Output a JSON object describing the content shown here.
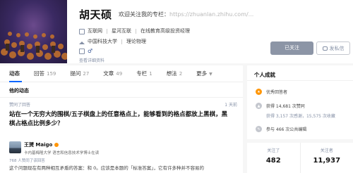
{
  "profile": {
    "name": "胡天硕",
    "headline_prefix": "欢迎关注我的专栏：",
    "headline_blurred": "https://zhuanlan.zhihu.com/...",
    "industry": "互联网",
    "company": "星河互联",
    "position": "在线教育高级投资经理",
    "school": "中国科技大学",
    "major": "理论物理",
    "gender_symbol": "♂",
    "edit_link": "查看详细资料"
  },
  "actions": {
    "follow_label": "已关注",
    "message_label": "发私信"
  },
  "tabs": [
    {
      "label": "动态",
      "count": ""
    },
    {
      "label": "回答",
      "count": "159"
    },
    {
      "label": "提问",
      "count": "27"
    },
    {
      "label": "文章",
      "count": "49"
    },
    {
      "label": "专栏",
      "count": "1"
    },
    {
      "label": "想法",
      "count": "2"
    },
    {
      "label": "更多",
      "count": ""
    }
  ],
  "feed": {
    "section_title": "他的动态",
    "item": {
      "action_label": "赞同了回答",
      "time": "1 天前",
      "question_title": "站在一个无穷大的围棋/五子棋盘上的任意格点上，能够看到的格点都放上黑棋，黑棋占格点比例多少？",
      "author_name": "王赟 Maigo",
      "author_bio": "卡内基梅隆大学 语言和信息技术学博士在读",
      "agree_count": "768 人赞同了该回答",
      "excerpt": "这个问题现在有两种相互矛盾的答案：和 0。应该是本题的「标准答案」，它有许多种并不容易的"
    }
  },
  "achievements": {
    "title": "个人成就",
    "items": [
      {
        "label": "优秀回答者",
        "icon": "medal-icon",
        "sub": ""
      },
      {
        "label": "获得 14,681 次赞同",
        "icon": "thumb-icon",
        "sub": ""
      },
      {
        "label": "获得 3,157 次感谢，15,575 次收藏",
        "icon": "heart-icon",
        "sub": ""
      },
      {
        "label": "参与 466 次公共编辑",
        "icon": "edit-icon",
        "sub": ""
      }
    ]
  },
  "follow_stats": {
    "following_label": "关注了",
    "following_value": "482",
    "followers_label": "关注者",
    "followers_value": "11,937"
  },
  "colors": {
    "accent": "#0066ff",
    "follow_btn": "#8c95a6",
    "badge_orange": "#ff9607"
  }
}
